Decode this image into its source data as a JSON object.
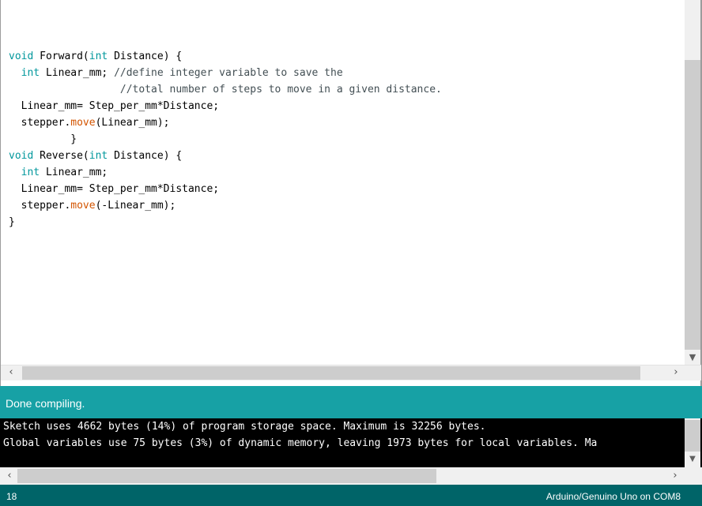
{
  "editor": {
    "code_lines": [
      [],
      [
        {
          "t": "void",
          "c": "kw"
        },
        {
          "t": " Forward(",
          "c": ""
        },
        {
          "t": "int",
          "c": "kw"
        },
        {
          "t": " Distance) {",
          "c": ""
        }
      ],
      [
        {
          "t": "  ",
          "c": ""
        },
        {
          "t": "int",
          "c": "kw"
        },
        {
          "t": " Linear_mm; ",
          "c": ""
        },
        {
          "t": "//define integer variable to save the",
          "c": "cm"
        }
      ],
      [
        {
          "t": "                  //total number of steps to move in a given distance.",
          "c": "cm"
        }
      ],
      [
        {
          "t": "  Linear_mm= Step_per_mm*Distance;",
          "c": ""
        }
      ],
      [
        {
          "t": "  stepper.",
          "c": ""
        },
        {
          "t": "move",
          "c": "fn"
        },
        {
          "t": "(Linear_mm);",
          "c": ""
        }
      ],
      [
        {
          "t": "          }",
          "c": ""
        }
      ],
      [
        {
          "t": "void",
          "c": "kw"
        },
        {
          "t": " Reverse(",
          "c": ""
        },
        {
          "t": "int",
          "c": "kw"
        },
        {
          "t": " Distance) {",
          "c": ""
        }
      ],
      [
        {
          "t": "  ",
          "c": ""
        },
        {
          "t": "int",
          "c": "kw"
        },
        {
          "t": " Linear_mm;",
          "c": ""
        }
      ],
      [
        {
          "t": "  Linear_mm= Step_per_mm*Distance;",
          "c": ""
        }
      ],
      [
        {
          "t": "  stepper.",
          "c": ""
        },
        {
          "t": "move",
          "c": "fn"
        },
        {
          "t": "(-Linear_mm);",
          "c": ""
        }
      ],
      [
        {
          "t": "}",
          "c": ""
        }
      ]
    ]
  },
  "status": {
    "message": "Done compiling."
  },
  "console": {
    "lines": [
      "Sketch uses 4662 bytes (14%) of program storage space. Maximum is 32256 bytes.",
      "Global variables use 75 bytes (3%) of dynamic memory, leaving 1973 bytes for local variables. Ma"
    ]
  },
  "footer": {
    "line_number": "18",
    "board": "Arduino/Genuino Uno on COM8"
  },
  "icons": {
    "scroll_left": "‹",
    "scroll_right": "›",
    "scroll_down": "▼"
  },
  "colors": {
    "status_bar": "#17a1a5",
    "footer_bar": "#006468",
    "keyword": "#00979c",
    "function": "#d35400",
    "comment": "#434f54"
  }
}
